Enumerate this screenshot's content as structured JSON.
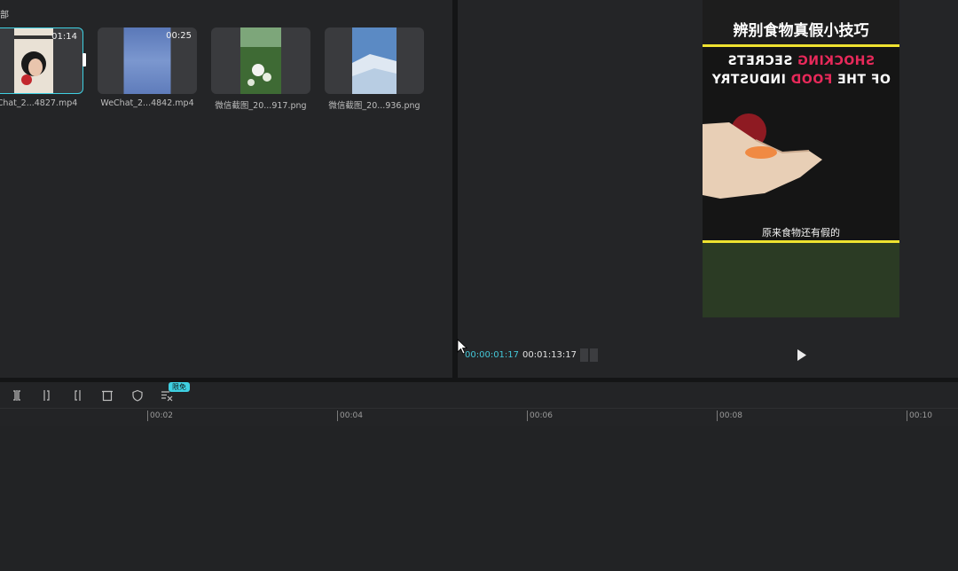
{
  "media": {
    "header_label": "部",
    "items": [
      {
        "duration": "01:14",
        "name": "Chat_2...4827.mp4",
        "selected": true
      },
      {
        "duration": "00:25",
        "name": "WeChat_2...4842.mp4",
        "selected": false
      },
      {
        "duration": "",
        "name": "微信截图_20...917.png",
        "selected": false
      },
      {
        "duration": "",
        "name": "微信截图_20...936.png",
        "selected": false
      }
    ]
  },
  "preview": {
    "video_title": "辨别食物真假小技巧",
    "video_en_line1_a": "SHOCKING",
    "video_en_line1_b": " SECRETS",
    "video_en_line2_a": "OF THE ",
    "video_en_line2_b": "FOOD",
    "video_en_line2_c": " INDUSTRY",
    "video_subtitle": "原来食物还有假的",
    "timecode_current": "00:00:01:17",
    "timecode_total": "00:01:13:17"
  },
  "timeline": {
    "free_badge": "限免",
    "ruler_labels": [
      "00:02",
      "00:04",
      "00:06",
      "00:08",
      "00:10"
    ]
  },
  "colors": {
    "accent": "#3fd0e2",
    "highlight_yellow": "#efe230",
    "highlight_red": "#e8295a"
  }
}
